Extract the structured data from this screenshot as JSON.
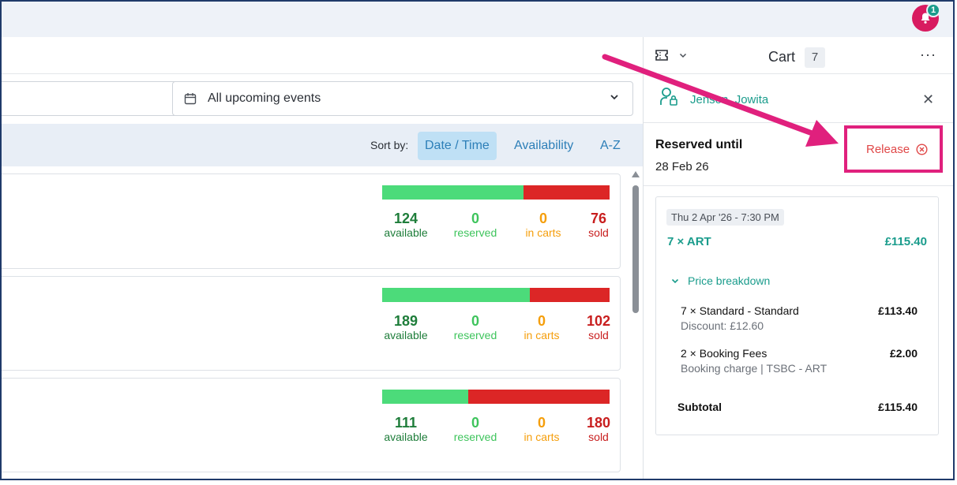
{
  "notification": {
    "count": "1"
  },
  "filter": {
    "label": "All upcoming events"
  },
  "sort": {
    "label": "Sort by:",
    "options": [
      "Date / Time",
      "Availability",
      "A-Z"
    ],
    "active": "Date / Time"
  },
  "events": [
    {
      "available": "124",
      "reserved": "0",
      "in_carts": "0",
      "sold": "76",
      "available_fraction": 0.62
    },
    {
      "available": "189",
      "reserved": "0",
      "in_carts": "0",
      "sold": "102",
      "available_fraction": 0.65
    },
    {
      "available": "111",
      "reserved": "0",
      "in_carts": "0",
      "sold": "180",
      "available_fraction": 0.38
    }
  ],
  "stat_labels": {
    "available": "available",
    "reserved": "reserved",
    "in_carts": "in carts",
    "sold": "sold"
  },
  "cart": {
    "title": "Cart",
    "count": "7",
    "customer_name": "Jenson, Jowita",
    "reserved_title": "Reserved until",
    "reserved_date": "28 Feb 26",
    "release_label": "Release",
    "order": {
      "date": "Thu 2 Apr '26 - 7:30 PM",
      "ticket_line": "7 × ART",
      "ticket_price": "£115.40",
      "breakdown_label": "Price breakdown",
      "items": [
        {
          "name": "7 × Standard - Standard",
          "sub": "Discount: £12.60",
          "amount": "£113.40"
        },
        {
          "name": "2 × Booking Fees",
          "sub": "Booking charge | TSBC - ART",
          "amount": "£2.00"
        }
      ],
      "subtotal_label": "Subtotal",
      "subtotal_amount": "£115.40"
    }
  },
  "colors": {
    "accent_teal": "#1a9c8c",
    "available_green": "#4cdb7a",
    "sold_red": "#dc2626",
    "annotation_pink": "#e0207d"
  }
}
